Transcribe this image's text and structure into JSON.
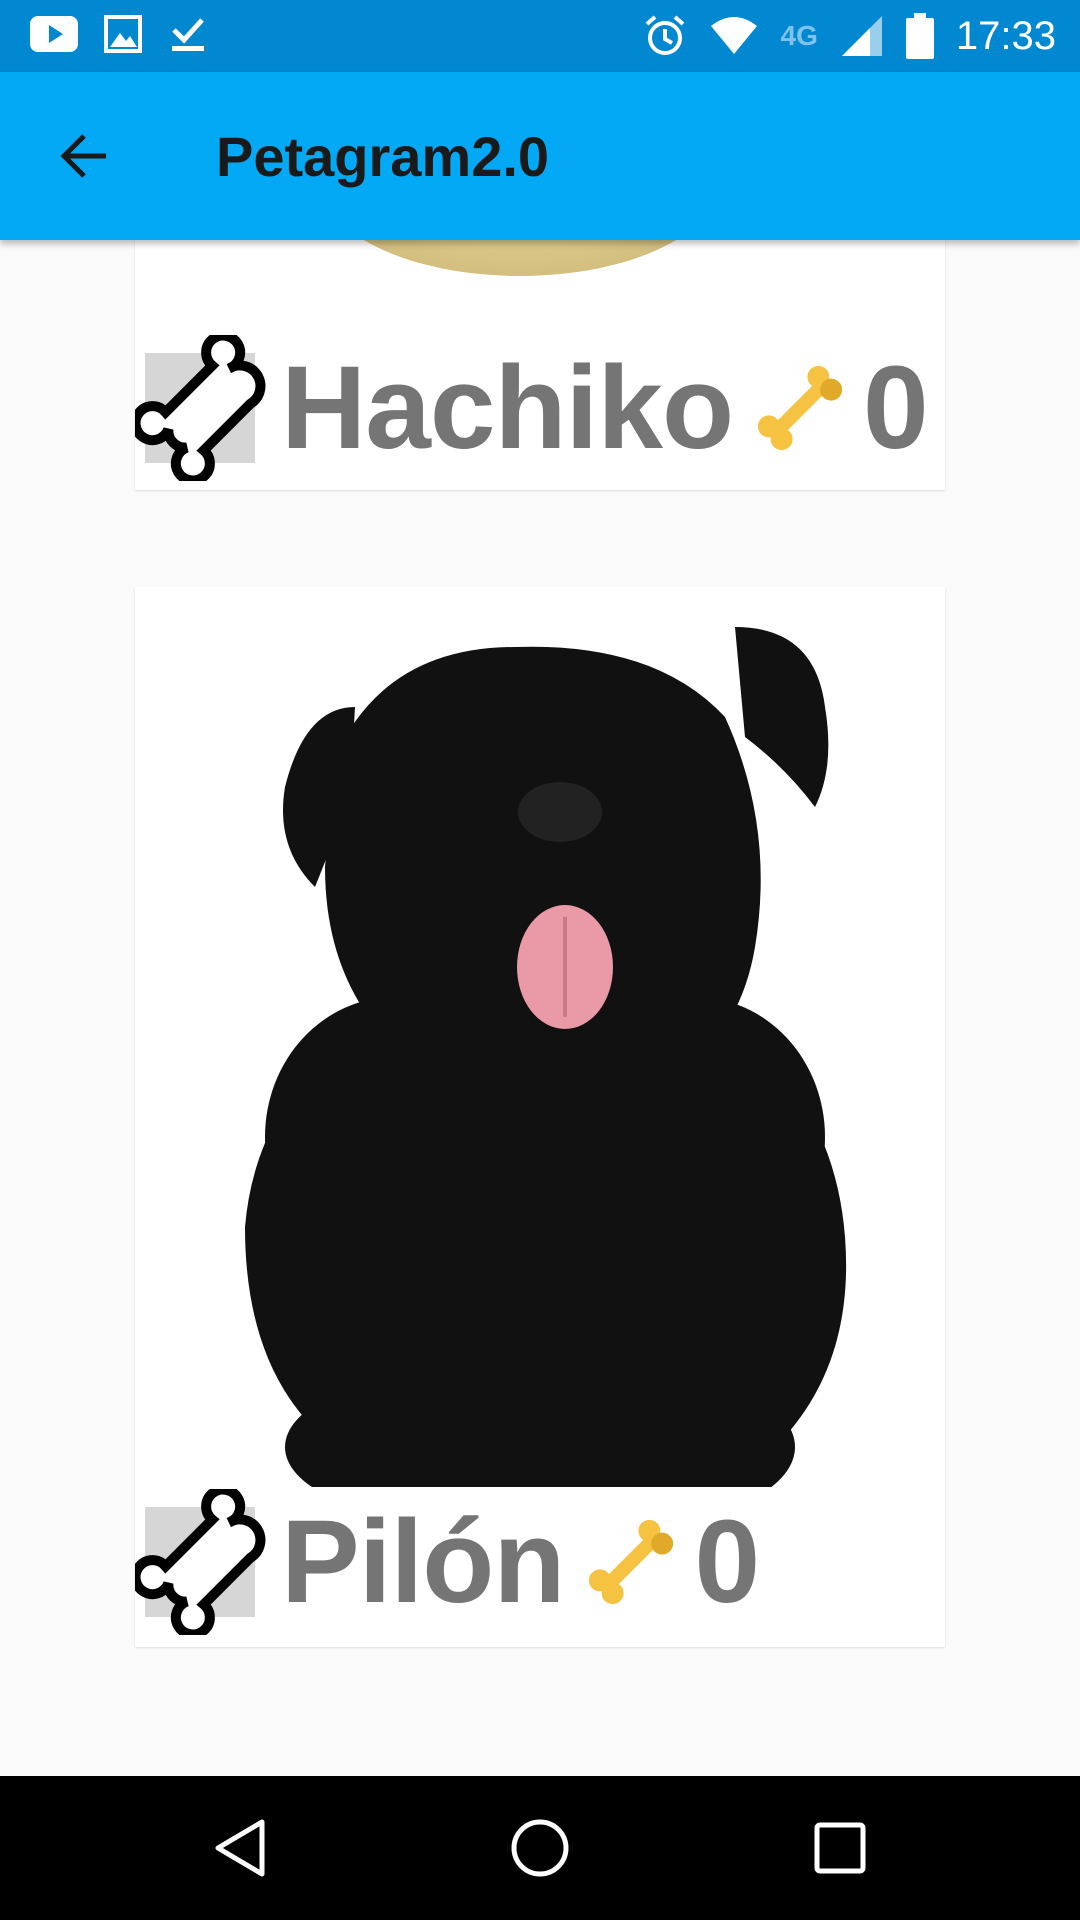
{
  "status_bar": {
    "time": "17:33",
    "network": "4G",
    "icons": [
      "youtube-icon",
      "gallery-icon",
      "download-done-icon",
      "alarm-icon",
      "wifi-icon",
      "signal-icon",
      "battery-icon"
    ]
  },
  "app_bar": {
    "title": "Petagram2.0",
    "back_icon": "arrow-back-icon"
  },
  "pets": [
    {
      "name": "Hachiko",
      "likes": "0",
      "rate_icon": "bone-outline-icon",
      "likes_icon": "gold-bone-icon"
    },
    {
      "name": "Pilón",
      "likes": "0",
      "rate_icon": "bone-outline-icon",
      "likes_icon": "gold-bone-icon"
    }
  ],
  "colors": {
    "status_bar": "#0288d1",
    "app_bar": "#03a9f4",
    "name_text": "#757575",
    "gold_bone": "#f5c242"
  },
  "nav_bar": {
    "icons": [
      "back-triangle-icon",
      "home-circle-icon",
      "recents-square-icon"
    ]
  }
}
